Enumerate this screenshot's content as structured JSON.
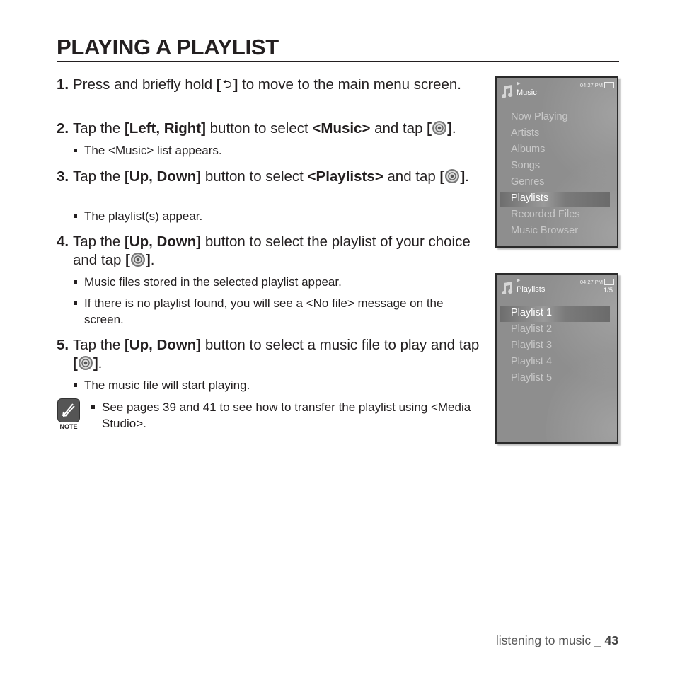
{
  "page": {
    "title": "PLAYING A PLAYLIST",
    "steps": [
      {
        "num": "1.",
        "parts": [
          "Press and briefly hold ",
          "[",
          "back-icon",
          "]",
          " to move to the main menu screen."
        ]
      },
      {
        "num": "2.",
        "t1": "Tap the ",
        "b1": "[Left, Right]",
        "t2": " button to select ",
        "b2": "<Music>",
        "t3": " and tap ",
        "bullets": [
          "The <Music> list appears."
        ]
      },
      {
        "num": "3.",
        "t1": "Tap the ",
        "b1": "[Up, Down]",
        "t2": " button to select ",
        "b2": "<Playlists>",
        "t3": " and tap ",
        "bullets": [
          "The playlist(s) appear."
        ]
      },
      {
        "num": "4.",
        "t1": "Tap the ",
        "b1": "[Up, Down]",
        "t2": " button to select the playlist of your choice and tap ",
        "bullets": [
          "Music files stored in the selected playlist appear.",
          "If there is no playlist found, you will see a <No file> message on the screen."
        ]
      },
      {
        "num": "5.",
        "t1": "Tap the ",
        "b1": "[Up, Down]",
        "t2": " button to select a music file to play and tap ",
        "bullets": [
          "The music file will start playing."
        ]
      }
    ],
    "step1_t1": "Press and briefly hold ",
    "step1_t2": " to move to the main menu screen.",
    "note": {
      "label": "NOTE",
      "text": "See pages 39 and 41 to see how to transfer the playlist using <Media Studio>."
    },
    "footer": {
      "section": "listening to music _ ",
      "page_number": "43"
    }
  },
  "screens": {
    "music": {
      "title": "Music",
      "clock": "04:27 PM",
      "items": [
        "Now Playing",
        "Artists",
        "Albums",
        "Songs",
        "Genres",
        "Playlists",
        "Recorded Files",
        "Music Browser"
      ],
      "selected": "Playlists"
    },
    "playlists": {
      "title": "Playlists",
      "clock": "04:27 PM",
      "count": "1/5",
      "items": [
        "Playlist 1",
        "Playlist 2",
        "Playlist 3",
        "Playlist 4",
        "Playlist 5"
      ],
      "selected": "Playlist 1"
    }
  },
  "icons": {
    "back": "back-arrow-icon",
    "ok": "select-button-icon",
    "note": "note-pencil-icon",
    "music": "music-note-icon",
    "battery": "battery-icon"
  }
}
